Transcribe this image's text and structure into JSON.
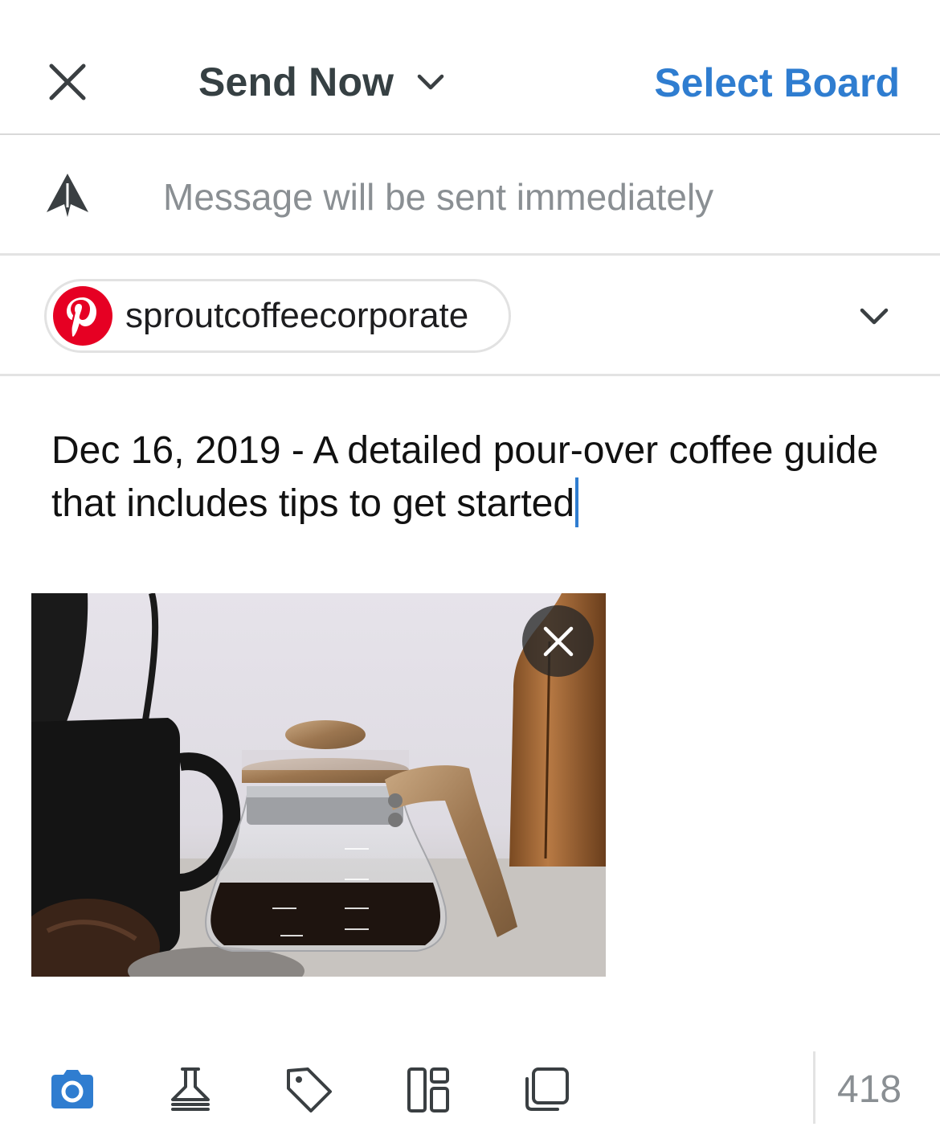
{
  "header": {
    "send_mode_label": "Send Now",
    "select_board_label": "Select Board"
  },
  "schedule": {
    "info_text": "Message will be sent immediately"
  },
  "profile": {
    "network": "pinterest",
    "name": "sproutcoffeecorporate"
  },
  "message": {
    "text": "Dec 16, 2019 - A detailed pour-over coffee guide that includes tips to get started"
  },
  "toolbar": {
    "icons": [
      "camera-icon",
      "flask-icon",
      "tag-icon",
      "layout-icon",
      "copy-icon"
    ],
    "char_count": "418"
  },
  "colors": {
    "accent": "#2f7dd0",
    "header_text": "#364043",
    "muted_text": "#8a8f93",
    "pinterest": "#e60023"
  }
}
